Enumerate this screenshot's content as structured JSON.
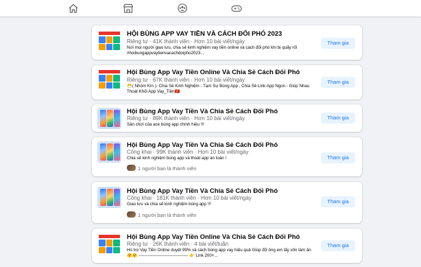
{
  "nav": {
    "icons": [
      "home-icon",
      "marketplace-icon",
      "groups-icon",
      "gaming-icon"
    ]
  },
  "groups": [
    {
      "title": "HỘI BÙNG APP VAY TIỀN VÀ CÁCH ĐỐI PHÓ 2023",
      "meta": "Riêng tư · 41K thành viên · Hơn 10 bài viết/ngày",
      "description": "Nơi mọi người giao lưu, chia sẻ kinh nghiệm vay tiền online và cách đối phó khi bị quấy rối #hoibungappvaytienvacachdoipho2023...",
      "friends": "",
      "join_label": "Tham gia"
    },
    {
      "title": "Hội Bùng App Vay Tiền Online Và Chia Sẻ Cách Đối Phó",
      "meta": "Riêng tư · 67K thành viên · Hơn 10 bài viết/ngày",
      "description": "😷( Nhóm Kín )- Chia Sẻ Kinh Nghiệm - Tạm Sự Bùng App , Chia Sẻ Link App Ngon - Giúp Nhau Thoát Khỏi App Vay_Tiền🇻🇳",
      "friends": "",
      "join_label": "Tham gia"
    },
    {
      "title": "Hội Bùng App Vay Tiền Và Chia Sẻ Cách Đối Phó",
      "meta": "Riêng tư · 89K thành viên · Hơn 10 bài viết/ngày",
      "description": "Sân chơi của ace bùng app chính hiệu !!!",
      "friends": "",
      "join_label": "Tham gia"
    },
    {
      "title": "Hội Bùng App Vay Tiền Và Chia Sẻ Cách Đối Phó",
      "meta": "Công khai · 99K thành viên · Hơn 10 bài viết/ngày",
      "description": "Chia sẻ kinh nghiệm bùng app và thoát app an toàn !",
      "friends": "1 người bạn là thành viên",
      "join_label": "Tham gia"
    },
    {
      "title": "Hội Bùng App Vay Tiền Và Chia Sẻ Cách Đối Phó",
      "meta": "Công khai · 181K thành viên · Hơn 10 bài viết/ngày",
      "description": "Giao lưu và chia sẻ kinh nghiệm bùng app !!!",
      "friends": "1 người bạn là thành viên",
      "join_label": "Tham gia"
    },
    {
      "title": "Hội Bùng App Vay Tiền Online Và Chia Sẻ Cách Đối Phó",
      "meta": "Riêng tư · 26K thành viên · 4 bài viết/tuần",
      "description": "Hỗ trợ Vay Tiền Online duyệt 99% và cách bùng app vay hiệu quả Giúp đỡ ông em lấy vốn làm ăn 🤗🤗 ----------------------------------- 👉 Link 200+...",
      "friends": "",
      "join_label": "Tham gia"
    }
  ]
}
